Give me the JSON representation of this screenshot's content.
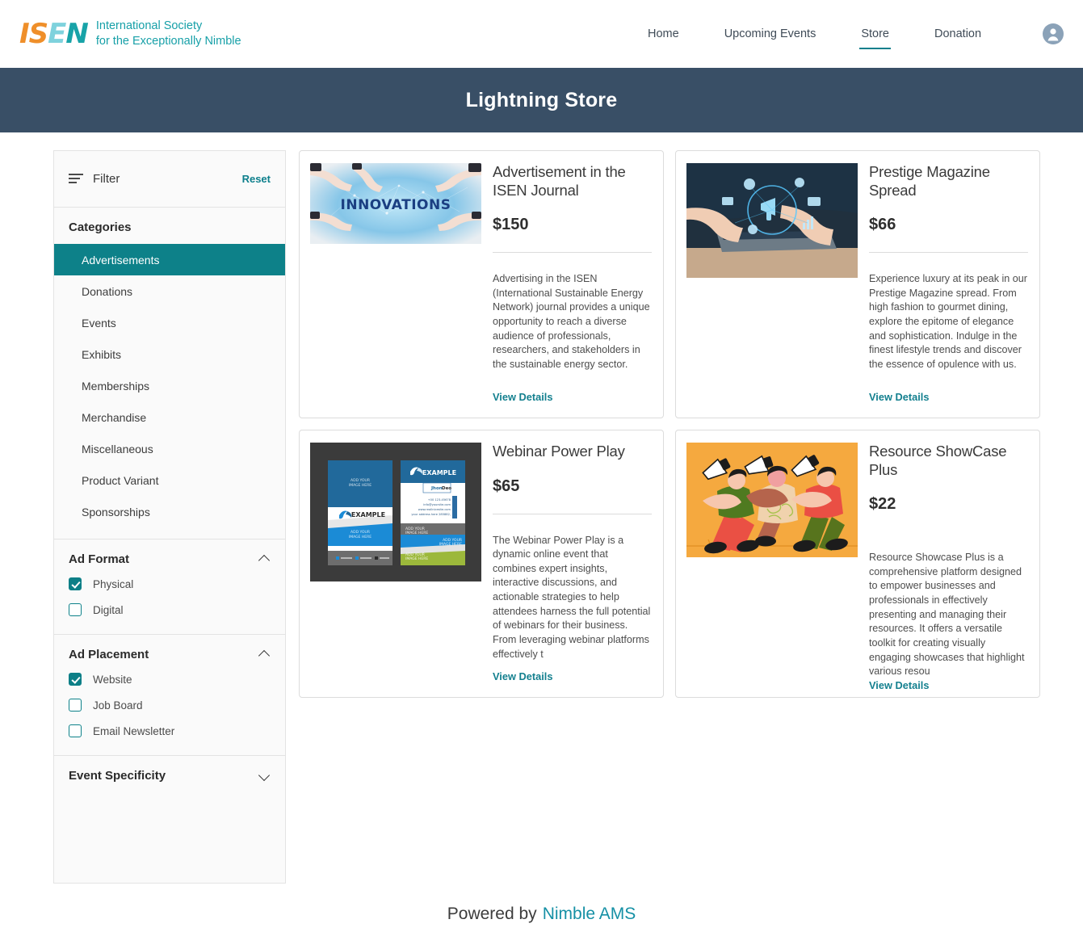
{
  "brand": {
    "mark_letters": [
      "I",
      "S",
      "E",
      "N"
    ],
    "line1": "International Society",
    "line2": "for the Exceptionally Nimble",
    "colors": {
      "orange": "#ef8f2a",
      "cyan": "#7fd2dd",
      "teal": "#18a3a8"
    }
  },
  "nav": {
    "items": [
      {
        "label": "Home",
        "active": false
      },
      {
        "label": "Upcoming Events",
        "active": false
      },
      {
        "label": "Store",
        "active": true
      },
      {
        "label": "Donation",
        "active": false
      }
    ],
    "avatar_icon": "user-avatar-icon"
  },
  "banner": {
    "title": "Lightning Store",
    "background": "#394f66"
  },
  "filter": {
    "icon": "filter-lines-icon",
    "title": "Filter",
    "reset_label": "Reset",
    "categories": {
      "title": "Categories",
      "items": [
        {
          "label": "Advertisements",
          "active": true
        },
        {
          "label": "Donations",
          "active": false
        },
        {
          "label": "Events",
          "active": false
        },
        {
          "label": "Exhibits",
          "active": false
        },
        {
          "label": "Memberships",
          "active": false
        },
        {
          "label": "Merchandise",
          "active": false
        },
        {
          "label": "Miscellaneous",
          "active": false
        },
        {
          "label": "Product Variant",
          "active": false
        },
        {
          "label": "Sponsorships",
          "active": false
        }
      ]
    },
    "ad_format": {
      "title": "Ad Format",
      "expanded": true,
      "chevron": "chevron-up-icon",
      "options": [
        {
          "label": "Physical",
          "checked": true
        },
        {
          "label": "Digital",
          "checked": false
        }
      ]
    },
    "ad_placement": {
      "title": "Ad Placement",
      "expanded": true,
      "chevron": "chevron-up-icon",
      "options": [
        {
          "label": "Website",
          "checked": true
        },
        {
          "label": "Job Board",
          "checked": false
        },
        {
          "label": "Email Newsletter",
          "checked": false
        }
      ]
    },
    "event_specificity": {
      "title": "Event Specificity",
      "expanded": false,
      "chevron": "chevron-down-icon"
    },
    "accent_color": "#0d8189"
  },
  "products": [
    {
      "title": "Advertisement in the ISEN Journal",
      "price": "$150",
      "description": "Advertising in the ISEN (International Sustainable Energy Network) journal provides a unique opportunity to reach a diverse audience of professionals, researchers, and stakeholders in the sustainable energy sector.",
      "link_label": "View Details",
      "image_name": "innovations-pointing-hands-image",
      "image_caption": "INNOVATIONS"
    },
    {
      "title": "Prestige Magazine Spread",
      "price": "$66",
      "description": "Experience luxury at its peak in our Prestige Magazine spread. From high fashion to gourmet dining, explore the epitome of elegance and sophistication. Indulge in the finest lifestyle trends and discover the essence of opulence with us.",
      "link_label": "View Details",
      "image_name": "tablet-megaphone-marketing-image",
      "image_caption": ""
    },
    {
      "title": "Webinar Power Play",
      "price": "$65",
      "description": "The Webinar Power Play is a dynamic online event that combines expert insights, interactive discussions, and actionable strategies to help attendees harness the full potential of webinars for their business. From leveraging webinar platforms effectively t",
      "link_label": "View Details",
      "image_name": "business-card-templates-image",
      "image_caption": "EXAMPLE"
    },
    {
      "title": "Resource ShowCase Plus",
      "price": "$22",
      "description": "Resource Showcase Plus is a comprehensive platform designed to empower businesses and professionals in effectively presenting and managing their resources. It offers a versatile toolkit for creating visually engaging showcases that highlight various resou",
      "link_label": "View Details",
      "image_name": "people-with-megaphones-illustration",
      "image_caption": ""
    }
  ],
  "footer": {
    "prefix": "Powered by",
    "brand": "Nimble AMS",
    "brand_color": "#1590a5"
  }
}
